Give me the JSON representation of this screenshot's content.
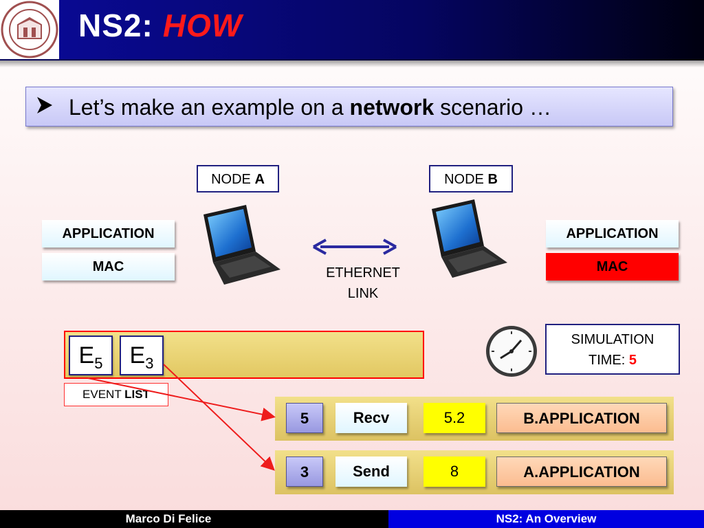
{
  "header": {
    "title_prefix": "NS2:",
    "title_accent": "HOW",
    "logo_text": "ALMA MATER STUDIORUM · A.D. 1088"
  },
  "bullet": {
    "text_before": "Let’s make an example on a ",
    "bold": "network",
    "text_after": " scenario …"
  },
  "nodes": {
    "a": {
      "label": "NODE ",
      "bold": "A"
    },
    "b": {
      "label": "NODE ",
      "bold": "B"
    }
  },
  "left_stack": {
    "application": "APPLICATION",
    "mac": "MAC"
  },
  "right_stack": {
    "application": "APPLICATION",
    "mac": "MAC"
  },
  "link": {
    "line1": "ETHERNET",
    "line2": "LINK"
  },
  "event_list": {
    "events": [
      {
        "letter": "E",
        "sub": "5"
      },
      {
        "letter": "E",
        "sub": "3"
      }
    ],
    "label": "EVENT ",
    "label_bold": "LIST"
  },
  "simulation": {
    "line1": "SIMULATION",
    "line2": "TIME: ",
    "value": "5"
  },
  "event_rows": [
    {
      "id": "5",
      "action": "Recv",
      "time": "5.2",
      "destination": "B.APPLICATION"
    },
    {
      "id": "3",
      "action": "Send",
      "time": "8",
      "destination": "A.APPLICATION"
    }
  ],
  "footer": {
    "author": "Marco Di Felice",
    "topic": "NS2: An Overview"
  },
  "colors": {
    "header_blue": "#0a0a9a",
    "accent_red": "#ff1a1a",
    "mac_red": "#ff0000",
    "time_yellow": "#ffff00",
    "footer_blue": "#0000e0"
  },
  "icons": [
    "university-seal",
    "laptop-icon",
    "double-arrow-icon",
    "clock-icon",
    "arrow-icon"
  ]
}
